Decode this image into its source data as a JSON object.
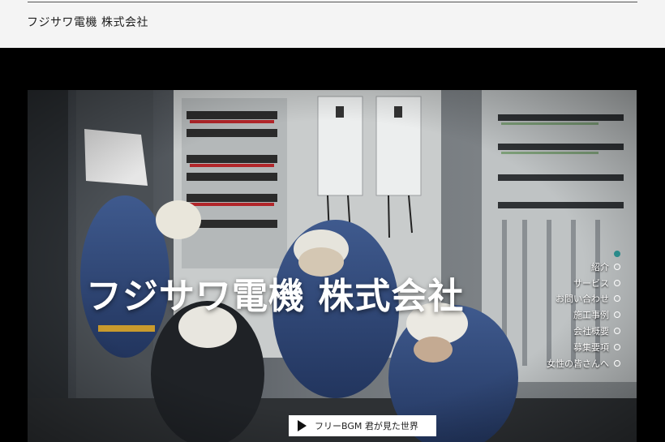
{
  "header": {
    "brand": "フジサワ電機 株式会社"
  },
  "hero": {
    "title": "フジサワ電機 株式会社"
  },
  "nav": {
    "items": [
      {
        "label": ""
      },
      {
        "label": "紹介"
      },
      {
        "label": "サービス"
      },
      {
        "label": "お問い合わせ"
      },
      {
        "label": "施工事例"
      },
      {
        "label": "会社概要"
      },
      {
        "label": "募集要項"
      },
      {
        "label": "女性の皆さんへ"
      }
    ],
    "active_color": "#2a8a8a"
  },
  "bgm": {
    "label": "フリーBGM 君が見た世界",
    "icon": "play-icon"
  }
}
